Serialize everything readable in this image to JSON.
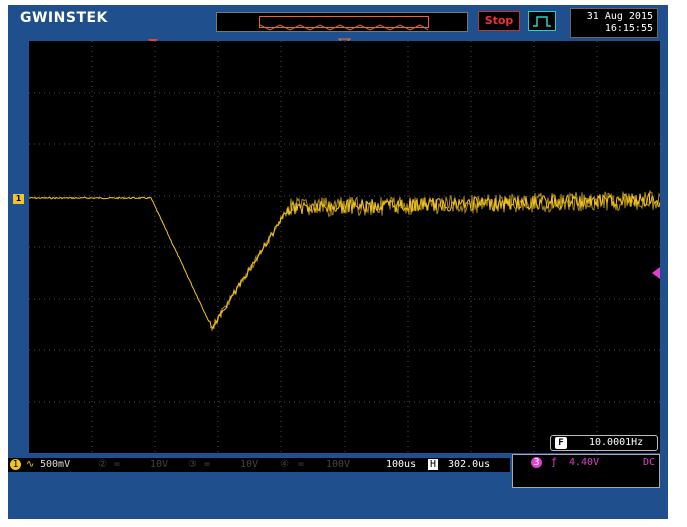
{
  "header": {
    "brand": "GWINSTEK",
    "run_state": "Stop",
    "date": "31 Aug 2015",
    "time": "16:15:55"
  },
  "status": {
    "ch1_scale": "500mV",
    "ch2_scale": "10V",
    "ch3_scale": "10V",
    "ch4_scale": "100V",
    "timebase": "100us",
    "position": "302.0us"
  },
  "trigger": {
    "source": "3",
    "level": "4.40V",
    "coupling": "DC"
  },
  "frequency": "10.0001Hz",
  "ch1_label": "1",
  "colors": {
    "ch1": "#f3c522",
    "ch3": "#e040d0",
    "stop": "#e53030"
  }
}
